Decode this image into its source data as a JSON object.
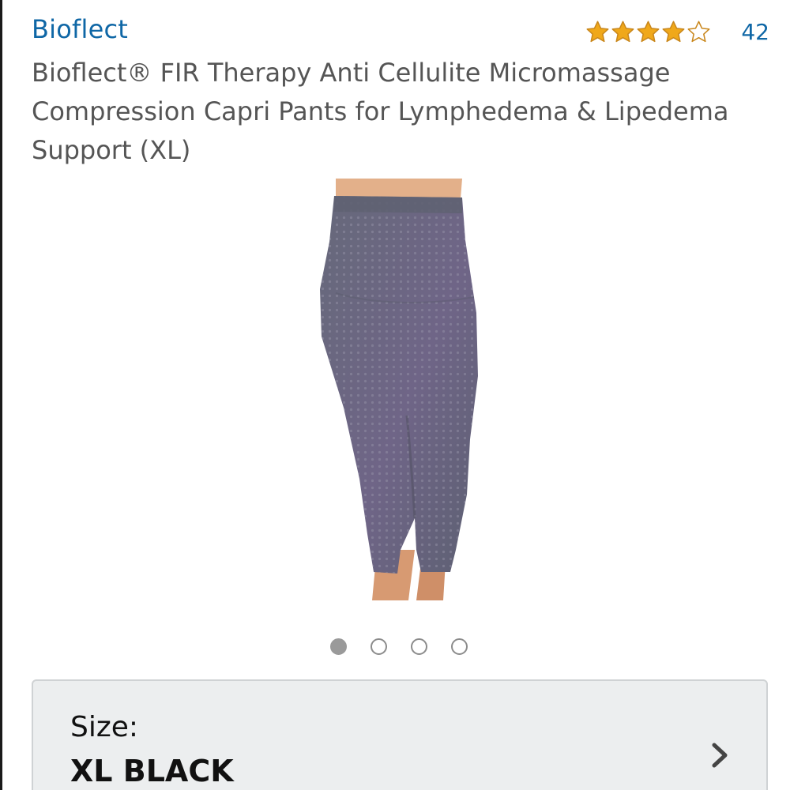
{
  "product": {
    "brand": "Bioflect",
    "title": "Bioflect® FIR Therapy Anti Cellulite Micromassage Compression Capri Pants for Lymphedema & Lipedema Support (XL)"
  },
  "rating": {
    "stars": 4.5,
    "max_stars": 5,
    "review_count": "42",
    "star_color": "#f0a81a",
    "star_outline_color": "#c9871c"
  },
  "gallery": {
    "image_count": 4,
    "active_index": 0
  },
  "size_selector": {
    "label": "Size:",
    "value": "XL BLACK"
  },
  "colors": {
    "link": "#0f67a6",
    "text": "#555555",
    "card_background": "#eceeef"
  }
}
